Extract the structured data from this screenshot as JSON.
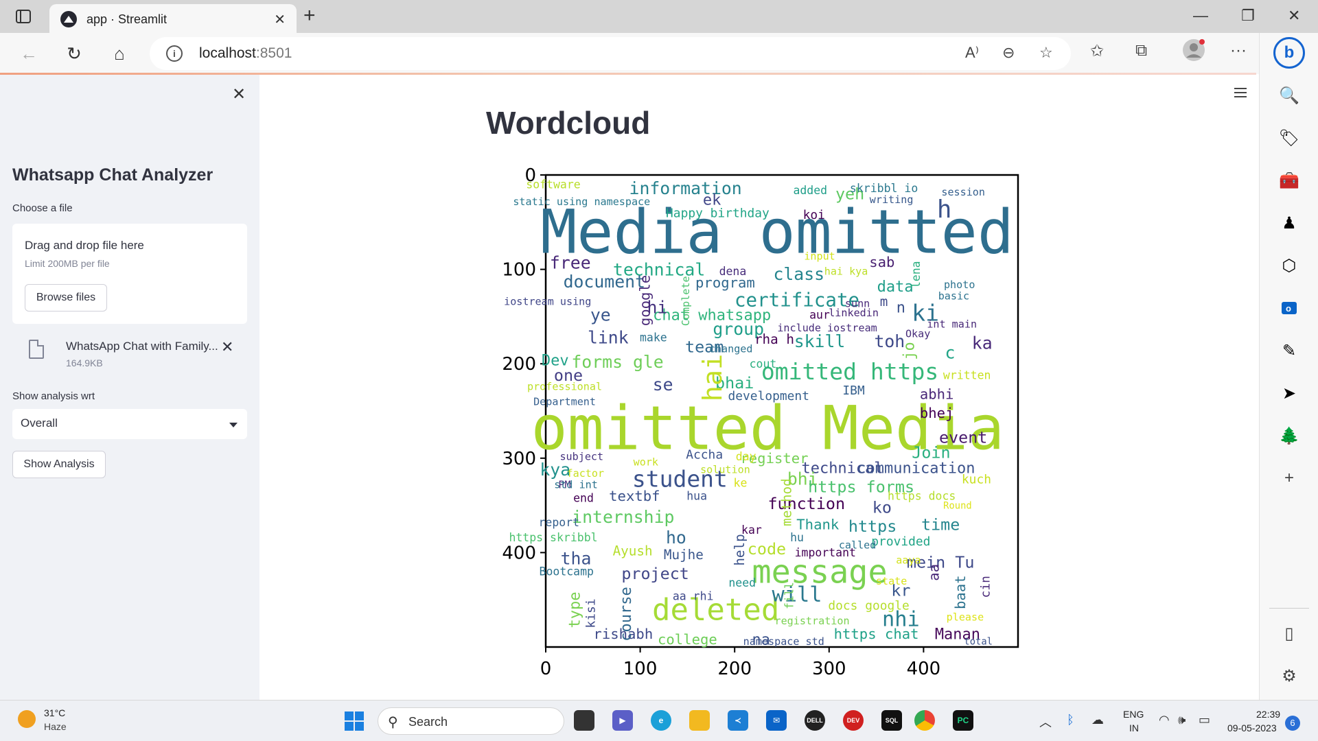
{
  "browser": {
    "tab_title": "app · Streamlit",
    "url_host": "localhost",
    "url_port": ":8501"
  },
  "sidebar": {
    "title": "Whatsapp Chat Analyzer",
    "file_label": "Choose a file",
    "dropzone_title": "Drag and drop file here",
    "dropzone_limit": "Limit 200MB per file",
    "browse_label": "Browse files",
    "file_name": "WhatsApp Chat with Family...",
    "file_size": "164.9KB",
    "wrt_label": "Show analysis wrt",
    "select_value": "Overall",
    "show_button": "Show Analysis"
  },
  "main": {
    "title": "Wordcloud"
  },
  "chart_data": {
    "type": "wordcloud",
    "xticks": [
      0,
      100,
      200,
      300,
      400
    ],
    "yticks": [
      0,
      100,
      200,
      300,
      400
    ],
    "xlim": [
      0,
      500
    ],
    "ylim": [
      500,
      0
    ],
    "words": [
      {
        "text": "Media omitted",
        "x": 245,
        "y": 60,
        "size": 64,
        "color": "#2e6e8e"
      },
      {
        "text": "omitted Media",
        "x": 235,
        "y": 268,
        "size": 64,
        "color": "#a9d62c"
      },
      {
        "text": "message",
        "x": 290,
        "y": 420,
        "size": 34,
        "color": "#7ad151"
      },
      {
        "text": "deleted",
        "x": 180,
        "y": 460,
        "size": 32,
        "color": "#a5db36"
      },
      {
        "text": "student",
        "x": 142,
        "y": 322,
        "size": 24,
        "color": "#3b528b"
      },
      {
        "text": "omitted https",
        "x": 322,
        "y": 208,
        "size": 24,
        "color": "#35b779"
      },
      {
        "text": "certificate",
        "x": 266,
        "y": 132,
        "size": 20,
        "color": "#21918c"
      },
      {
        "text": "information",
        "x": 148,
        "y": 14,
        "size": 18,
        "color": "#26828e"
      },
      {
        "text": "technical",
        "x": 120,
        "y": 100,
        "size": 18,
        "color": "#22a884"
      },
      {
        "text": "document",
        "x": 62,
        "y": 113,
        "size": 18,
        "color": "#31688e"
      },
      {
        "text": "class",
        "x": 268,
        "y": 105,
        "size": 18,
        "color": "#25858e"
      },
      {
        "text": "free",
        "x": 26,
        "y": 93,
        "size": 18,
        "color": "#482878"
      },
      {
        "text": "chat whatsapp",
        "x": 176,
        "y": 148,
        "size": 16,
        "color": "#2fb47c"
      },
      {
        "text": "program",
        "x": 190,
        "y": 114,
        "size": 15,
        "color": "#31688e"
      },
      {
        "text": "group",
        "x": 204,
        "y": 163,
        "size": 18,
        "color": "#1f9e89"
      },
      {
        "text": "link",
        "x": 66,
        "y": 172,
        "size": 18,
        "color": "#3e4989"
      },
      {
        "text": "team",
        "x": 168,
        "y": 182,
        "size": 17,
        "color": "#31688e"
      },
      {
        "text": "forms gle",
        "x": 76,
        "y": 198,
        "size": 18,
        "color": "#6ece58"
      },
      {
        "text": "skill",
        "x": 290,
        "y": 176,
        "size": 18,
        "color": "#1f968b"
      },
      {
        "text": "toh",
        "x": 364,
        "y": 176,
        "size": 18,
        "color": "#3e4989"
      },
      {
        "text": "ka",
        "x": 462,
        "y": 178,
        "size": 18,
        "color": "#482878"
      },
      {
        "text": "ki",
        "x": 402,
        "y": 146,
        "size": 24,
        "color": "#2c728e"
      },
      {
        "text": "h",
        "x": 422,
        "y": 36,
        "size": 26,
        "color": "#3b528b"
      },
      {
        "text": "yeh",
        "x": 322,
        "y": 20,
        "size": 17,
        "color": "#5ec962"
      },
      {
        "text": "ek",
        "x": 176,
        "y": 26,
        "size": 16,
        "color": "#404688"
      },
      {
        "text": "data",
        "x": 370,
        "y": 118,
        "size": 16,
        "color": "#1f9e89"
      },
      {
        "text": "sab",
        "x": 356,
        "y": 92,
        "size": 15,
        "color": "#481f70"
      },
      {
        "text": "ye",
        "x": 58,
        "y": 148,
        "size": 18,
        "color": "#39568c"
      },
      {
        "text": "hi",
        "x": 118,
        "y": 140,
        "size": 18,
        "color": "#46327e"
      },
      {
        "text": "one",
        "x": 24,
        "y": 212,
        "size": 17,
        "color": "#433e85"
      },
      {
        "text": "se",
        "x": 124,
        "y": 222,
        "size": 18,
        "color": "#3e4989"
      },
      {
        "text": "bhai",
        "x": 200,
        "y": 220,
        "size": 17,
        "color": "#29af7f"
      },
      {
        "text": "Dev",
        "x": 10,
        "y": 196,
        "size": 16,
        "color": "#1fa188"
      },
      {
        "text": "c",
        "x": 428,
        "y": 188,
        "size": 18,
        "color": "#20a486"
      },
      {
        "text": "abhi",
        "x": 414,
        "y": 232,
        "size": 15,
        "color": "#482677"
      },
      {
        "text": "bhej",
        "x": 414,
        "y": 252,
        "size": 15,
        "color": "#440154"
      },
      {
        "text": "event",
        "x": 442,
        "y": 278,
        "size": 17,
        "color": "#481a6c"
      },
      {
        "text": "IBM",
        "x": 326,
        "y": 228,
        "size": 13,
        "color": "#355f8d"
      },
      {
        "text": "development",
        "x": 236,
        "y": 234,
        "size": 13,
        "color": "#355f8d"
      },
      {
        "text": "Join",
        "x": 408,
        "y": 294,
        "size": 17,
        "color": "#29af7f"
      },
      {
        "text": "technical",
        "x": 314,
        "y": 310,
        "size": 16,
        "color": "#3e4989"
      },
      {
        "text": "communication",
        "x": 392,
        "y": 310,
        "size": 16,
        "color": "#3b528b"
      },
      {
        "text": "register",
        "x": 242,
        "y": 300,
        "size": 15,
        "color": "#75d054"
      },
      {
        "text": "bhi",
        "x": 272,
        "y": 322,
        "size": 18,
        "color": "#7ad151"
      },
      {
        "text": "https forms",
        "x": 334,
        "y": 330,
        "size": 17,
        "color": "#4ac16d"
      },
      {
        "text": "function",
        "x": 276,
        "y": 348,
        "size": 17,
        "color": "#440154"
      },
      {
        "text": "ko",
        "x": 356,
        "y": 352,
        "size": 17,
        "color": "#3e4989"
      },
      {
        "text": "time",
        "x": 418,
        "y": 370,
        "size": 17,
        "color": "#25858e"
      },
      {
        "text": "https",
        "x": 346,
        "y": 372,
        "size": 17,
        "color": "#23898e"
      },
      {
        "text": "Thank",
        "x": 288,
        "y": 370,
        "size": 15,
        "color": "#1f968b"
      },
      {
        "text": "kya",
        "x": 10,
        "y": 312,
        "size": 18,
        "color": "#21918c"
      },
      {
        "text": "internship",
        "x": 82,
        "y": 362,
        "size": 18,
        "color": "#5ec962"
      },
      {
        "text": "textbf",
        "x": 94,
        "y": 340,
        "size": 15,
        "color": "#3b528b"
      },
      {
        "text": "ho",
        "x": 138,
        "y": 384,
        "size": 18,
        "color": "#31688e"
      },
      {
        "text": "tha",
        "x": 32,
        "y": 406,
        "size": 18,
        "color": "#3b528b"
      },
      {
        "text": "project",
        "x": 116,
        "y": 422,
        "size": 17,
        "color": "#404688"
      },
      {
        "text": "code",
        "x": 234,
        "y": 396,
        "size": 17,
        "color": "#b5de2b"
      },
      {
        "text": "will",
        "x": 266,
        "y": 444,
        "size": 22,
        "color": "#2a788e"
      },
      {
        "text": "nhi",
        "x": 376,
        "y": 470,
        "size": 22,
        "color": "#277f8e"
      },
      {
        "text": "kr",
        "x": 376,
        "y": 440,
        "size": 17,
        "color": "#39568c"
      },
      {
        "text": "mein Tu",
        "x": 418,
        "y": 410,
        "size": 17,
        "color": "#3e4989"
      },
      {
        "text": "Manan",
        "x": 436,
        "y": 486,
        "size": 16,
        "color": "#46075a"
      },
      {
        "text": "https chat",
        "x": 350,
        "y": 486,
        "size": 15,
        "color": "#1fa188"
      },
      {
        "text": "college",
        "x": 150,
        "y": 492,
        "size": 15,
        "color": "#6ece58"
      },
      {
        "text": "na",
        "x": 228,
        "y": 492,
        "size": 16,
        "color": "#3b528b"
      },
      {
        "text": "rishabh",
        "x": 82,
        "y": 486,
        "size": 15,
        "color": "#3e4989"
      },
      {
        "text": "Mujhe",
        "x": 146,
        "y": 402,
        "size": 14,
        "color": "#39568c"
      },
      {
        "text": "Ayush",
        "x": 92,
        "y": 398,
        "size": 14,
        "color": "#b5de2b"
      },
      {
        "text": "Bootcamp",
        "x": 22,
        "y": 420,
        "size": 12,
        "color": "#2c728e"
      },
      {
        "text": "report",
        "x": 14,
        "y": 368,
        "size": 12,
        "color": "#355f8d"
      },
      {
        "text": "https skribbl",
        "x": 8,
        "y": 384,
        "size": 12,
        "color": "#4ac16d"
      },
      {
        "text": "end",
        "x": 40,
        "y": 342,
        "size": 12,
        "color": "#440154"
      },
      {
        "text": "Accha",
        "x": 168,
        "y": 296,
        "size": 13,
        "color": "#3b528b"
      },
      {
        "text": "important",
        "x": 296,
        "y": 400,
        "size": 12,
        "color": "#440154"
      },
      {
        "text": "provided",
        "x": 376,
        "y": 388,
        "size": 13,
        "color": "#20a486"
      },
      {
        "text": "docs google",
        "x": 342,
        "y": 456,
        "size": 13,
        "color": "#b5de2b"
      },
      {
        "text": "registration",
        "x": 282,
        "y": 472,
        "size": 11,
        "color": "#7ad151"
      },
      {
        "text": "namespace std",
        "x": 252,
        "y": 494,
        "size": 11,
        "color": "#3b528b"
      },
      {
        "text": "need",
        "x": 208,
        "y": 432,
        "size": 12,
        "color": "#21918c"
      },
      {
        "text": "aa rhi",
        "x": 156,
        "y": 446,
        "size": 12,
        "color": "#3e4989"
      },
      {
        "text": "Happy birthday",
        "x": 182,
        "y": 40,
        "size": 13,
        "color": "#20a486"
      },
      {
        "text": "koi",
        "x": 284,
        "y": 42,
        "size": 13,
        "color": "#440154"
      },
      {
        "text": "added",
        "x": 280,
        "y": 16,
        "size": 12,
        "color": "#1f9e89"
      },
      {
        "text": "skribbl io",
        "x": 358,
        "y": 14,
        "size": 12,
        "color": "#2a788e"
      },
      {
        "text": "session",
        "x": 442,
        "y": 18,
        "size": 11,
        "color": "#355f8d"
      },
      {
        "text": "writing",
        "x": 366,
        "y": 26,
        "size": 11,
        "color": "#38588c"
      },
      {
        "text": "software",
        "x": 8,
        "y": 10,
        "size": 12,
        "color": "#b8de29"
      },
      {
        "text": "static using namespace",
        "x": 38,
        "y": 28,
        "size": 11,
        "color": "#2a788e"
      },
      {
        "text": "dena",
        "x": 198,
        "y": 102,
        "size": 12,
        "color": "#472c7a"
      },
      {
        "text": "hai kya",
        "x": 318,
        "y": 102,
        "size": 11,
        "color": "#bddf26"
      },
      {
        "text": "input",
        "x": 290,
        "y": 86,
        "size": 11,
        "color": "#d2e21b"
      },
      {
        "text": "photo",
        "x": 438,
        "y": 116,
        "size": 11,
        "color": "#2c728e"
      },
      {
        "text": "basic",
        "x": 432,
        "y": 128,
        "size": 11,
        "color": "#2c728e"
      },
      {
        "text": "iostream using",
        "x": 2,
        "y": 134,
        "size": 11,
        "color": "#404688"
      },
      {
        "text": "sunn",
        "x": 330,
        "y": 136,
        "size": 11,
        "color": "#482878"
      },
      {
        "text": "m",
        "x": 358,
        "y": 134,
        "size": 14,
        "color": "#3e4989"
      },
      {
        "text": "n",
        "x": 376,
        "y": 140,
        "size": 16,
        "color": "#3b528b"
      },
      {
        "text": "linkedin",
        "x": 326,
        "y": 146,
        "size": 11,
        "color": "#482677"
      },
      {
        "text": "aur",
        "x": 290,
        "y": 148,
        "size": 12,
        "color": "#440154"
      },
      {
        "text": "include iostream",
        "x": 298,
        "y": 162,
        "size": 11,
        "color": "#472c7a"
      },
      {
        "text": "int main",
        "x": 430,
        "y": 158,
        "size": 11,
        "color": "#482878"
      },
      {
        "text": "Okay",
        "x": 394,
        "y": 168,
        "size": 11,
        "color": "#472c7a"
      },
      {
        "text": "rha h",
        "x": 242,
        "y": 174,
        "size": 14,
        "color": "#440154"
      },
      {
        "text": "make",
        "x": 114,
        "y": 172,
        "size": 12,
        "color": "#2c728e"
      },
      {
        "text": "changed",
        "x": 196,
        "y": 184,
        "size": 11,
        "color": "#2c728e"
      },
      {
        "text": "cout",
        "x": 230,
        "y": 200,
        "size": 12,
        "color": "#29af7f"
      },
      {
        "text": "professional",
        "x": 20,
        "y": 224,
        "size": 11,
        "color": "#bddf26"
      },
      {
        "text": "written",
        "x": 446,
        "y": 212,
        "size": 12,
        "color": "#c8e020"
      },
      {
        "text": "Department",
        "x": 20,
        "y": 240,
        "size": 11,
        "color": "#355f8d"
      },
      {
        "text": "subject",
        "x": 38,
        "y": 298,
        "size": 11,
        "color": "#46337f"
      },
      {
        "text": "work",
        "x": 106,
        "y": 304,
        "size": 11,
        "color": "#c8e020"
      },
      {
        "text": "day",
        "x": 212,
        "y": 298,
        "size": 12,
        "color": "#d2e21b"
      },
      {
        "text": "solution",
        "x": 190,
        "y": 312,
        "size": 11,
        "color": "#bddf26"
      },
      {
        "text": "factor",
        "x": 42,
        "y": 316,
        "size": 11,
        "color": "#c8e020"
      },
      {
        "text": "PM",
        "x": 20,
        "y": 328,
        "size": 11,
        "color": "#482878"
      },
      {
        "text": "std int",
        "x": 32,
        "y": 328,
        "size": 11,
        "color": "#2c728e"
      },
      {
        "text": "ke",
        "x": 206,
        "y": 326,
        "size": 12,
        "color": "#d8e219"
      },
      {
        "text": "hua",
        "x": 160,
        "y": 340,
        "size": 12,
        "color": "#3b528b"
      },
      {
        "text": "kuch",
        "x": 456,
        "y": 322,
        "size": 13,
        "color": "#c8e020"
      },
      {
        "text": "https docs",
        "x": 398,
        "y": 340,
        "size": 12,
        "color": "#b5de2b"
      },
      {
        "text": "Round",
        "x": 436,
        "y": 350,
        "size": 10,
        "color": "#dde318"
      },
      {
        "text": "kar",
        "x": 218,
        "y": 376,
        "size": 12,
        "color": "#440154"
      },
      {
        "text": "called",
        "x": 330,
        "y": 392,
        "size": 11,
        "color": "#2c728e"
      },
      {
        "text": "hu",
        "x": 266,
        "y": 384,
        "size": 12,
        "color": "#2c728e"
      },
      {
        "text": "aaya",
        "x": 384,
        "y": 408,
        "size": 11,
        "color": "#d2e21b"
      },
      {
        "text": "state",
        "x": 366,
        "y": 430,
        "size": 11,
        "color": "#d8e219"
      },
      {
        "text": "please",
        "x": 444,
        "y": 468,
        "size": 11,
        "color": "#dde318"
      },
      {
        "text": "total",
        "x": 458,
        "y": 494,
        "size": 10,
        "color": "#3b528b"
      }
    ],
    "vertical_words": [
      {
        "text": "hai",
        "x": 186,
        "y": 240,
        "size": 28,
        "color": "#c2df23"
      },
      {
        "text": "google",
        "x": 110,
        "y": 160,
        "size": 15,
        "color": "#482878"
      },
      {
        "text": "Complete",
        "x": 152,
        "y": 160,
        "size": 11,
        "color": "#4ac16d"
      },
      {
        "text": "lena",
        "x": 396,
        "y": 120,
        "size": 12,
        "color": "#29af7f"
      },
      {
        "text": "jo",
        "x": 390,
        "y": 196,
        "size": 16,
        "color": "#7ad151"
      },
      {
        "text": "method",
        "x": 260,
        "y": 372,
        "size": 14,
        "color": "#a5db36"
      },
      {
        "text": "help",
        "x": 210,
        "y": 414,
        "size": 14,
        "color": "#3b528b"
      },
      {
        "text": "fill",
        "x": 262,
        "y": 460,
        "size": 12,
        "color": "#6ece58"
      },
      {
        "text": "course",
        "x": 90,
        "y": 494,
        "size": 16,
        "color": "#31688e"
      },
      {
        "text": "type",
        "x": 36,
        "y": 480,
        "size": 16,
        "color": "#7ad151"
      },
      {
        "text": "kisi",
        "x": 52,
        "y": 480,
        "size": 13,
        "color": "#3e4989"
      },
      {
        "text": "aa",
        "x": 416,
        "y": 430,
        "size": 15,
        "color": "#482878"
      },
      {
        "text": "baat",
        "x": 444,
        "y": 460,
        "size": 15,
        "color": "#2c728e"
      },
      {
        "text": "cin",
        "x": 470,
        "y": 448,
        "size": 13,
        "color": "#482878"
      }
    ]
  },
  "taskbar": {
    "temp": "31°C",
    "weather": "Haze",
    "search": "Search",
    "lang1": "ENG",
    "lang2": "IN",
    "time": "22:39",
    "date": "09-05-2023",
    "notifications": "6"
  }
}
